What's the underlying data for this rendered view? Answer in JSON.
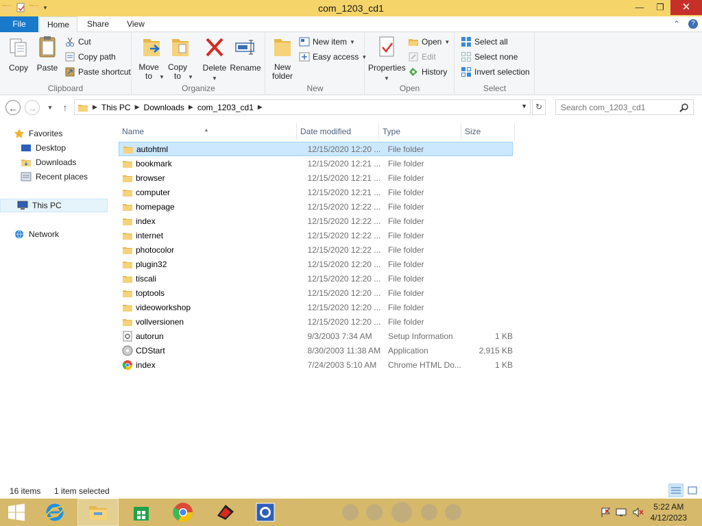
{
  "window": {
    "title": "com_1203_cd1",
    "minimize": "—",
    "maximize": "❐",
    "close": "✕"
  },
  "ribbon_tabs": {
    "file": "File",
    "home": "Home",
    "share": "Share",
    "view": "View"
  },
  "ribbon": {
    "clipboard": {
      "label": "Clipboard",
      "copy": "Copy",
      "paste": "Paste",
      "cut": "Cut",
      "copy_path": "Copy path",
      "paste_shortcut": "Paste shortcut"
    },
    "organize": {
      "label": "Organize",
      "move_to": "Move to",
      "copy_to": "Copy to",
      "delete": "Delete",
      "rename": "Rename"
    },
    "new": {
      "label": "New",
      "new_folder": "New folder",
      "new_item": "New item",
      "easy_access": "Easy access"
    },
    "open": {
      "label": "Open",
      "properties": "Properties",
      "open": "Open",
      "edit": "Edit",
      "history": "History"
    },
    "select": {
      "label": "Select",
      "select_all": "Select all",
      "select_none": "Select none",
      "invert_selection": "Invert selection"
    }
  },
  "address": {
    "crumbs": [
      "This PC",
      "Downloads",
      "com_1203_cd1"
    ],
    "search_placeholder": "Search com_1203_cd1"
  },
  "nav": {
    "favorites": "Favorites",
    "desktop": "Desktop",
    "downloads": "Downloads",
    "recent_places": "Recent places",
    "this_pc": "This PC",
    "network": "Network"
  },
  "columns": {
    "name": "Name",
    "date_modified": "Date modified",
    "type": "Type",
    "size": "Size"
  },
  "files": [
    {
      "name": "autohtml",
      "date": "12/15/2020 12:20 ...",
      "type": "File folder",
      "size": "",
      "icon": "folder"
    },
    {
      "name": "bookmark",
      "date": "12/15/2020 12:21 ...",
      "type": "File folder",
      "size": "",
      "icon": "folder"
    },
    {
      "name": "browser",
      "date": "12/15/2020 12:21 ...",
      "type": "File folder",
      "size": "",
      "icon": "folder"
    },
    {
      "name": "computer",
      "date": "12/15/2020 12:21 ...",
      "type": "File folder",
      "size": "",
      "icon": "folder"
    },
    {
      "name": "homepage",
      "date": "12/15/2020 12:22 ...",
      "type": "File folder",
      "size": "",
      "icon": "folder"
    },
    {
      "name": "index",
      "date": "12/15/2020 12:22 ...",
      "type": "File folder",
      "size": "",
      "icon": "folder"
    },
    {
      "name": "internet",
      "date": "12/15/2020 12:22 ...",
      "type": "File folder",
      "size": "",
      "icon": "folder"
    },
    {
      "name": "photocolor",
      "date": "12/15/2020 12:22 ...",
      "type": "File folder",
      "size": "",
      "icon": "folder"
    },
    {
      "name": "plugin32",
      "date": "12/15/2020 12:20 ...",
      "type": "File folder",
      "size": "",
      "icon": "folder"
    },
    {
      "name": "tiscali",
      "date": "12/15/2020 12:20 ...",
      "type": "File folder",
      "size": "",
      "icon": "folder"
    },
    {
      "name": "toptools",
      "date": "12/15/2020 12:20 ...",
      "type": "File folder",
      "size": "",
      "icon": "folder"
    },
    {
      "name": "videoworkshop",
      "date": "12/15/2020 12:20 ...",
      "type": "File folder",
      "size": "",
      "icon": "folder"
    },
    {
      "name": "vollversionen",
      "date": "12/15/2020 12:20 ...",
      "type": "File folder",
      "size": "",
      "icon": "folder"
    },
    {
      "name": "autorun",
      "date": "9/3/2003 7:34 AM",
      "type": "Setup Information",
      "size": "1 KB",
      "icon": "setup-file"
    },
    {
      "name": "CDStart",
      "date": "8/30/2003 11:38 AM",
      "type": "Application",
      "size": "2,915 KB",
      "icon": "cd-application"
    },
    {
      "name": "index",
      "date": "7/24/2003 5:10 AM",
      "type": "Chrome HTML Do...",
      "size": "1 KB",
      "icon": "chrome-html"
    }
  ],
  "selected_index": 0,
  "status": {
    "items": "16 items",
    "selection": "1 item selected"
  },
  "clock": {
    "time": "5:22 AM",
    "date": "4/12/2023"
  },
  "colors": {
    "titlebar": "#f5d46a",
    "file_tab": "#1979ca",
    "selection": "#cce8ff",
    "taskbar": "#d7b96b"
  }
}
